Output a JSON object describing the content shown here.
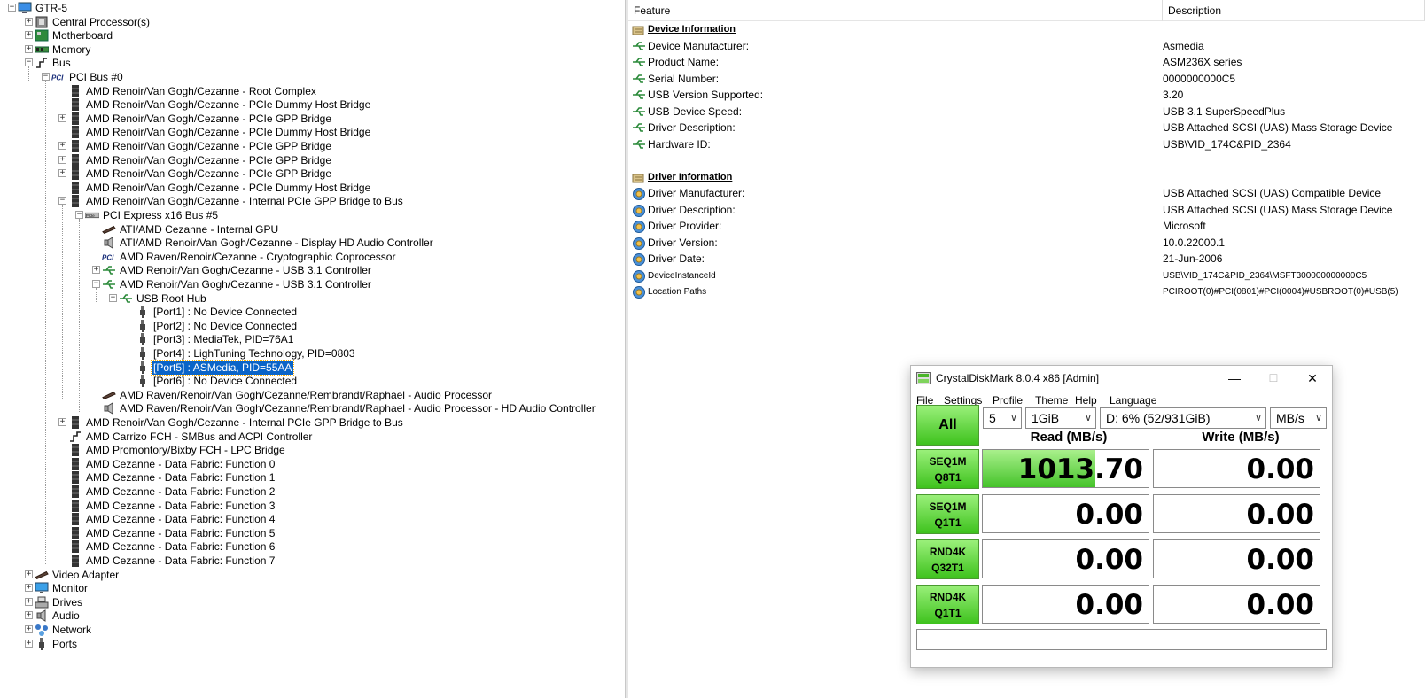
{
  "tree": {
    "root": "GTR-5",
    "categories_top": [
      "Central Processor(s)",
      "Motherboard",
      "Memory",
      "Bus"
    ],
    "pci_bus": "PCI Bus #0",
    "pci_items_a": [
      "AMD Renoir/Van Gogh/Cezanne - Root Complex",
      "AMD Renoir/Van Gogh/Cezanne - PCIe Dummy Host Bridge",
      "AMD Renoir/Van Gogh/Cezanne - PCIe GPP Bridge",
      "AMD Renoir/Van Gogh/Cezanne - PCIe Dummy Host Bridge",
      "AMD Renoir/Van Gogh/Cezanne - PCIe GPP Bridge",
      "AMD Renoir/Van Gogh/Cezanne - PCIe GPP Bridge",
      "AMD Renoir/Van Gogh/Cezanne - PCIe GPP Bridge",
      "AMD Renoir/Van Gogh/Cezanne - PCIe Dummy Host Bridge",
      "AMD Renoir/Van Gogh/Cezanne - Internal PCIe GPP Bridge to Bus"
    ],
    "pcie_bus": "PCI Express x16 Bus #5",
    "pcie_items": [
      "ATI/AMD Cezanne - Internal GPU",
      "ATI/AMD Renoir/Van Gogh/Cezanne - Display HD Audio Controller",
      "AMD Raven/Renoir/Cezanne - Cryptographic Coprocessor",
      "AMD Renoir/Van Gogh/Cezanne - USB 3.1 Controller",
      "AMD Renoir/Van Gogh/Cezanne - USB 3.1 Controller"
    ],
    "usb_hub": "USB Root Hub",
    "ports": [
      "[Port1] : No Device Connected",
      "[Port2] : No Device Connected",
      "[Port3] : MediaTek, PID=76A1",
      "[Port4] : LighTuning Technology, PID=0803",
      "[Port5] : ASMedia, PID=55AA",
      "[Port6] : No Device Connected"
    ],
    "pcie_items_after": [
      "AMD Raven/Renoir/Van Gogh/Cezanne/Rembrandt/Raphael - Audio Processor",
      "AMD Raven/Renoir/Van Gogh/Cezanne/Rembrandt/Raphael - Audio Processor - HD Audio Controller"
    ],
    "pci_items_b": [
      "AMD Renoir/Van Gogh/Cezanne - Internal PCIe GPP Bridge to Bus",
      "AMD Carrizo FCH - SMBus and ACPI Controller",
      "AMD Promontory/Bixby FCH - LPC Bridge",
      "AMD Cezanne - Data Fabric: Function 0",
      "AMD Cezanne - Data Fabric: Function 1",
      "AMD Cezanne - Data Fabric: Function 2",
      "AMD Cezanne - Data Fabric: Function 3",
      "AMD Cezanne - Data Fabric: Function 4",
      "AMD Cezanne - Data Fabric: Function 5",
      "AMD Cezanne - Data Fabric: Function 6",
      "AMD Cezanne - Data Fabric: Function 7"
    ],
    "categories_bottom": [
      "Video Adapter",
      "Monitor",
      "Drives",
      "Audio",
      "Network",
      "Ports"
    ]
  },
  "details": {
    "col_feature": "Feature",
    "col_description": "Description",
    "sections": [
      {
        "title": "Device Information",
        "rows": [
          {
            "feature": "Device Manufacturer:",
            "value": "Asmedia"
          },
          {
            "feature": "Product Name:",
            "value": "ASM236X series"
          },
          {
            "feature": "Serial Number:",
            "value": "0000000000C5"
          },
          {
            "feature": "USB Version Supported:",
            "value": "3.20"
          },
          {
            "feature": "USB Device Speed:",
            "value": "USB 3.1 SuperSpeedPlus"
          },
          {
            "feature": "Driver Description:",
            "value": "USB Attached SCSI (UAS) Mass Storage Device"
          },
          {
            "feature": "Hardware ID:",
            "value": "USB\\VID_174C&PID_2364"
          }
        ]
      },
      {
        "title": "Driver Information",
        "rows": [
          {
            "feature": "Driver Manufacturer:",
            "value": "USB Attached SCSI (UAS) Compatible Device"
          },
          {
            "feature": "Driver Description:",
            "value": "USB Attached SCSI (UAS) Mass Storage Device"
          },
          {
            "feature": "Driver Provider:",
            "value": "Microsoft"
          },
          {
            "feature": "Driver Version:",
            "value": "10.0.22000.1"
          },
          {
            "feature": "Driver Date:",
            "value": "21-Jun-2006"
          },
          {
            "feature": "DeviceInstanceId",
            "value": "USB\\VID_174C&PID_2364\\MSFT300000000000C5"
          },
          {
            "feature": "Location Paths",
            "value": "PCIROOT(0)#PCI(0801)#PCI(0004)#USBROOT(0)#USB(5)"
          }
        ]
      }
    ]
  },
  "cdm": {
    "title": "CrystalDiskMark 8.0.4 x86 [Admin]",
    "menu": [
      "File",
      "Settings",
      "Profile",
      "Theme",
      "Help",
      "Language"
    ],
    "all_button": "All",
    "count": "5",
    "size": "1GiB",
    "drive": "D: 6% (52/931GiB)",
    "unit": "MB/s",
    "read_header": "Read (MB/s)",
    "write_header": "Write (MB/s)",
    "tests": [
      {
        "l1": "SEQ1M",
        "l2": "Q8T1",
        "read": "1013.70",
        "write": "0.00",
        "read_fill": 0.68
      },
      {
        "l1": "SEQ1M",
        "l2": "Q1T1",
        "read": "0.00",
        "write": "0.00",
        "read_fill": 0
      },
      {
        "l1": "RND4K",
        "l2": "Q32T1",
        "read": "0.00",
        "write": "0.00",
        "read_fill": 0
      },
      {
        "l1": "RND4K",
        "l2": "Q1T1",
        "read": "0.00",
        "write": "0.00",
        "read_fill": 0
      }
    ],
    "comment": ""
  },
  "colors": {
    "selection": "#0a64c8",
    "cdm_green": "#3ec21d"
  }
}
